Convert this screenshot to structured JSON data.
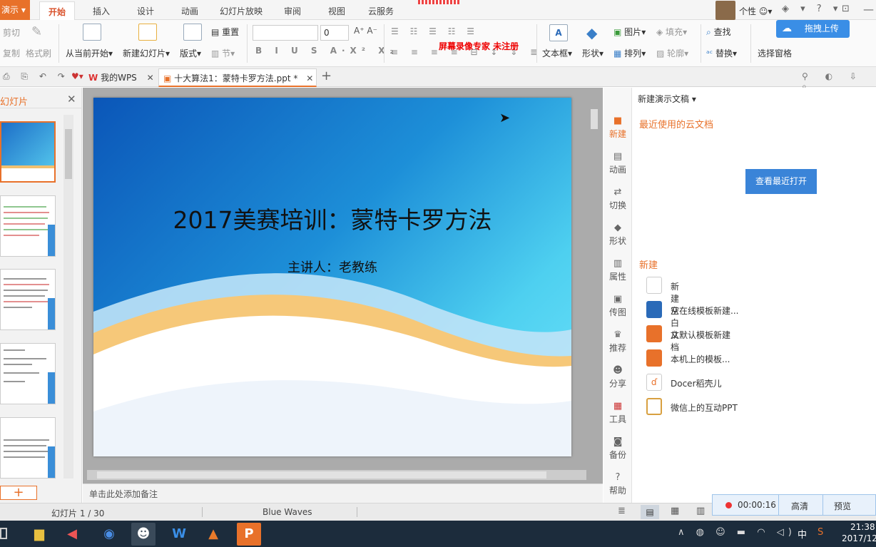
{
  "app": {
    "name": "演示"
  },
  "menu": [
    "开始",
    "插入",
    "设计",
    "动画",
    "幻灯片放映",
    "审阅",
    "视图",
    "云服务"
  ],
  "topright": {
    "personal": "个性"
  },
  "watermark": "屏幕录像专家 未注册",
  "upload_button": "拖拽上传",
  "ribbon": {
    "cut": "剪切",
    "copy": "复制",
    "format_painter": "格式刷",
    "play_from_current": "从当前开始",
    "new_slide": "新建幻灯片",
    "layout": "版式",
    "reset": "重置",
    "section": "节",
    "font_size": "0",
    "textbox": "文本框",
    "shape": "形状",
    "picture": "图片",
    "arrange": "排列",
    "fill": "填充",
    "outline": "轮廓",
    "find": "查找",
    "replace": "替换",
    "selection_pane": "选择窗格"
  },
  "tabs": [
    {
      "label": "我的WPS"
    },
    {
      "label": "十大算法1：蒙特卡罗方法.ppt *"
    }
  ],
  "left_panel": {
    "title": "幻灯片"
  },
  "slide": {
    "title": "2017美赛培训：蒙特卡罗方法",
    "subtitle": "主讲人：老教练"
  },
  "notes_placeholder": "单击此处添加备注",
  "rail": [
    "新建",
    "动画",
    "切换",
    "形状",
    "属性",
    "传图",
    "推荐",
    "分享",
    "工具",
    "备份",
    "帮助"
  ],
  "pane": {
    "header": "新建演示文稿",
    "recent_heading": "最近使用的云文档",
    "view_recent": "查看最近打开",
    "new_heading": "新建",
    "items": [
      "新建空白文档",
      "从在线模板新建...",
      "从默认模板新建",
      "本机上的模板...",
      "Docer稻壳儿",
      "微信上的互动PPT"
    ]
  },
  "status": {
    "slide_counter": "幻灯片 1 / 30",
    "theme": "Blue Waves"
  },
  "recorder": {
    "time": "00:00:16",
    "quality": "高清",
    "preview": "预览"
  },
  "taskbar": {
    "time": "21:38",
    "date": "2017/12",
    "ime": "中"
  }
}
